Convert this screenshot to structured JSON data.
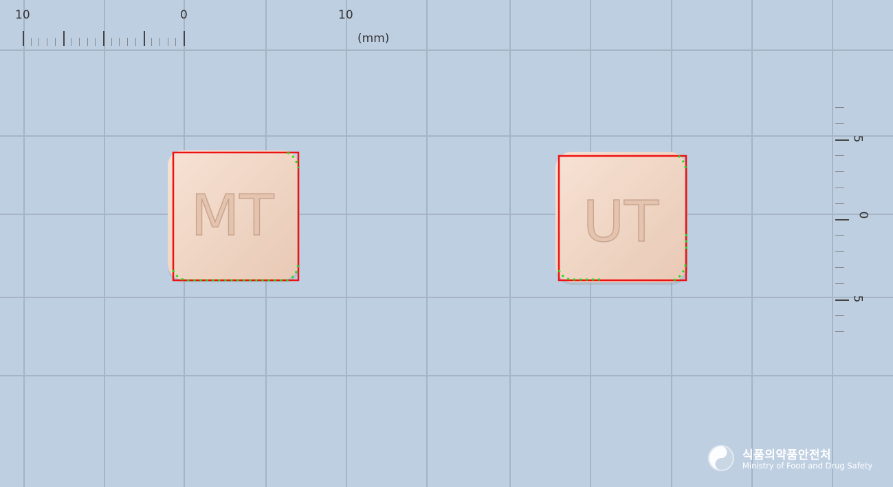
{
  "top_ruler": {
    "labels": [
      "10",
      "0",
      "10"
    ],
    "unit": "(mm)"
  },
  "side_ruler": {
    "labels": [
      "5",
      "0",
      "5"
    ]
  },
  "pills": [
    {
      "imprint": "MT",
      "name": "pill-left"
    },
    {
      "imprint": "UT",
      "name": "pill-right"
    }
  ],
  "colors": {
    "background": "#bfcfe2",
    "grid": "#a6b4c4",
    "pill": "#f2d9c8",
    "bounding_box": "#ff0000",
    "contour": "#22dd22"
  },
  "logo": {
    "korean": "식품의약품안전처",
    "english": "Ministry of Food and Drug Safety"
  }
}
